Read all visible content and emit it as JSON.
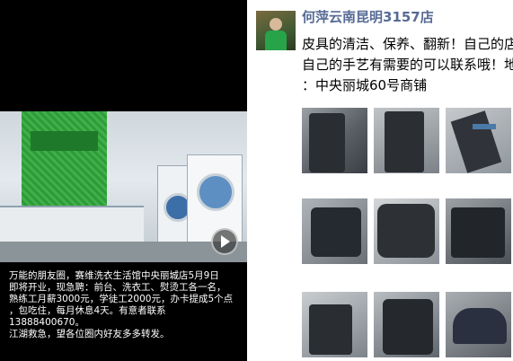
{
  "left_post": {
    "photo_alt": "store photo",
    "text_lines": [
      "万能的朋友圈，赛维洗衣生活馆中央丽城店5月9日",
      "即将开业，现急聘：前台、洗衣工、熨烫工各一名，",
      "熟练工月薪3000元，学徒工2000元，办卡提成5个点",
      "，包吃住，每月休息4天。有意者联系",
      "13888400670。",
      "江湖救急，望各位圈内好友多多转发。"
    ]
  },
  "right_post": {
    "user_name": "何萍云南昆明3157店",
    "content_lines": [
      "皮具的清洁、保养、翻新！自己的店",
      "自己的手艺有需要的可以联系哦！地",
      "：中央丽城60号商铺"
    ],
    "colors": {
      "name": "#576b95",
      "text": "#000000"
    }
  }
}
